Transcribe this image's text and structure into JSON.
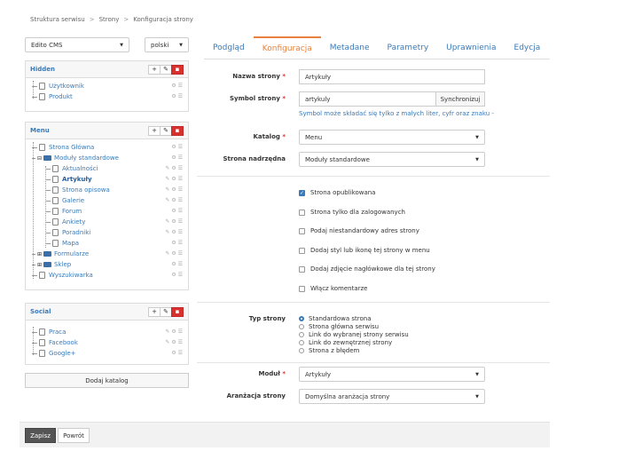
{
  "breadcrumb": [
    "Struktura serwisu",
    "Strony",
    "Konfiguracja strony"
  ],
  "sidebar": {
    "site_select": "Edito CMS",
    "lang_select": "polski",
    "panels": [
      {
        "title": "Hidden",
        "items": [
          "Użytkownik",
          "Produkt"
        ]
      },
      {
        "title": "Menu",
        "items": [
          "Strona Główna",
          "Moduły standardowe",
          "Aktualności",
          "Artykuły",
          "Strona opisowa",
          "Galerie",
          "Forum",
          "Ankiety",
          "Poradniki",
          "Mapa",
          "Formularze",
          "Sklep",
          "Wyszukiwarka"
        ]
      },
      {
        "title": "Social",
        "items": [
          "Praca",
          "Facebook",
          "Google+"
        ]
      }
    ],
    "add_catalog": "Dodaj katalog"
  },
  "tabs": [
    "Podgląd",
    "Konfiguracja",
    "Metadane",
    "Parametry",
    "Uprawnienia",
    "Edycja"
  ],
  "form": {
    "page_name_label": "Nazwa strony",
    "page_name_value": "Artykuły",
    "symbol_label": "Symbol strony",
    "symbol_value": "artykuly",
    "sync_button": "Synchronizuj",
    "symbol_hint": "Symbol może składać się tylko z małych liter, cyfr oraz znaku -",
    "catalog_label": "Katalog",
    "catalog_value": "Menu",
    "parent_label": "Strona nadrzędna",
    "parent_value": "Moduły standardowe",
    "checkboxes": [
      {
        "label": "Strona opublikowana",
        "checked": true
      },
      {
        "label": "Strona tylko dla zalogowanych",
        "checked": false
      },
      {
        "label": "Podaj niestandardowy adres strony",
        "checked": false
      },
      {
        "label": "Dodaj styl lub ikonę tej strony w menu",
        "checked": false
      },
      {
        "label": "Dodaj zdjęcie nagłówkowe dla tej strony",
        "checked": false
      },
      {
        "label": "Włącz komentarze",
        "checked": false
      }
    ],
    "type_label": "Typ strony",
    "types": [
      {
        "label": "Standardowa strona",
        "checked": true
      },
      {
        "label": "Strona główna serwisu",
        "checked": false
      },
      {
        "label": "Link do wybranej strony serwisu",
        "checked": false
      },
      {
        "label": "Link do zewnętrznej strony",
        "checked": false
      },
      {
        "label": "Strona z błędem",
        "checked": false
      }
    ],
    "module_label": "Moduł",
    "module_value": "Artykuły",
    "layout_label": "Aranżacja strony",
    "layout_value": "Domyślna aranżacja strony"
  },
  "footer": {
    "save": "Zapisz",
    "back": "Powrót"
  }
}
